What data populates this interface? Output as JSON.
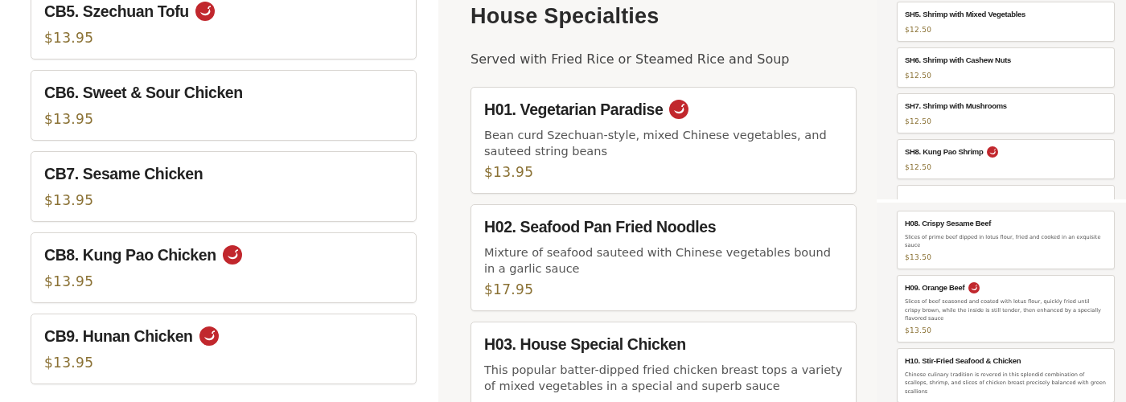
{
  "left": {
    "items": [
      {
        "name": "CB5. Szechuan Tofu",
        "price": "$13.95",
        "spicy": true
      },
      {
        "name": "CB6. Sweet & Sour Chicken",
        "price": "$13.95",
        "spicy": false
      },
      {
        "name": "CB7. Sesame Chicken",
        "price": "$13.95",
        "spicy": false
      },
      {
        "name": "CB8. Kung Pao Chicken",
        "price": "$13.95",
        "spicy": true
      },
      {
        "name": "CB9. Hunan Chicken",
        "price": "$13.95",
        "spicy": true
      }
    ]
  },
  "middle": {
    "heading": "House Specialties",
    "subtitle": "Served with Fried Rice or Steamed Rice and Soup",
    "items": [
      {
        "name": "H01. Vegetarian Paradise",
        "description": "Bean curd Szechuan-style, mixed Chinese vegetables, and sauteed string beans",
        "price": "$13.95",
        "spicy": true
      },
      {
        "name": "H02. Seafood Pan Fried Noodles",
        "description": "Mixture of seafood sauteed with Chinese vegetables bound in a garlic sauce",
        "price": "$17.95",
        "spicy": false
      },
      {
        "name": "H03. House Special Chicken",
        "description": "This popular batter-dipped fried chicken breast tops a variety of mixed vegetables in a special and superb sauce",
        "spicy": false
      }
    ]
  },
  "right_upper": {
    "items": [
      {
        "name": "SH5. Shrimp with Mixed Vegetables",
        "price": "$12.50",
        "spicy": false
      },
      {
        "name": "SH6. Shrimp with Cashew Nuts",
        "price": "$12.50",
        "spicy": false
      },
      {
        "name": "SH7. Shrimp with Mushrooms",
        "price": "$12.50",
        "spicy": false
      },
      {
        "name": "SH8. Kung Pao Shrimp",
        "price": "$12.50",
        "spicy": true
      }
    ]
  },
  "right_lower": {
    "items": [
      {
        "name": "H08. Crispy Sesame Beef",
        "description": "Slices of prime beef dipped in lotus flour, fried and cooked in an exquisite sauce",
        "price": "$13.50",
        "spicy": false
      },
      {
        "name": "H09. Orange Beef",
        "description": "Slices of beef seasoned and coated with lotus flour, quickly fried until crispy brown, while the inside is still tender, then enhanced by a specially flavored sauce",
        "price": "$13.50",
        "spicy": true
      },
      {
        "name": "H10. Stir-Fried Seafood & Chicken",
        "description": "Chinese culinary tradition is revered in this splendid combination of scallops, shrimp, and slices of chicken breast precisely balanced with green scallions",
        "spicy": false
      }
    ]
  }
}
